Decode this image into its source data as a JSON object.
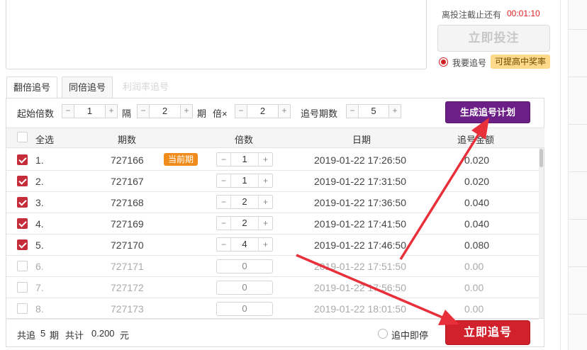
{
  "bet": {
    "deadline_label": "离投注截止还有",
    "deadline_time": "00:01:10",
    "bet_now_label": "立即投注",
    "want_chase_label": "我要追号",
    "rate_badge": "可提高中奖率"
  },
  "tabs": [
    {
      "label": "翻倍追号",
      "active": true
    },
    {
      "label": "同倍追号",
      "active": false
    },
    {
      "label": "利润率追号",
      "active": false,
      "disabled": true
    }
  ],
  "controls": {
    "start_multiple_label": "起始倍数",
    "start_multiple": "1",
    "every_label": "隔",
    "every_value": "2",
    "period_label": "期",
    "times_label": "倍×",
    "times_value": "2",
    "chase_periods_label": "追号期数",
    "chase_periods": "5",
    "generate_label": "生成追号计划"
  },
  "table": {
    "headers": {
      "select_all": "全选",
      "period": "期数",
      "multiple": "倍数",
      "date": "日期",
      "amount": "追号金额"
    },
    "current_badge": "当前期",
    "rows": [
      {
        "idx": "1.",
        "period": "727166",
        "multiple": "1",
        "date": "2019-01-22 17:26:50",
        "amount": "0.020",
        "checked": true
      },
      {
        "idx": "2.",
        "period": "727167",
        "multiple": "1",
        "date": "2019-01-22 17:31:50",
        "amount": "0.020",
        "checked": true
      },
      {
        "idx": "3.",
        "period": "727168",
        "multiple": "2",
        "date": "2019-01-22 17:36:50",
        "amount": "0.040",
        "checked": true
      },
      {
        "idx": "4.",
        "period": "727169",
        "multiple": "2",
        "date": "2019-01-22 17:41:50",
        "amount": "0.040",
        "checked": true
      },
      {
        "idx": "5.",
        "period": "727170",
        "multiple": "4",
        "date": "2019-01-22 17:46:50",
        "amount": "0.080",
        "checked": true
      },
      {
        "idx": "6.",
        "period": "727171",
        "multiple": "0",
        "date": "2019-01-22 17:51:50",
        "amount": "0.00",
        "checked": false
      },
      {
        "idx": "7.",
        "period": "727172",
        "multiple": "0",
        "date": "2019-01-22 17:56:50",
        "amount": "0.00",
        "checked": false
      },
      {
        "idx": "8.",
        "period": "727173",
        "multiple": "0",
        "date": "2019-01-22 18:01:50",
        "amount": "0.00",
        "checked": false
      }
    ]
  },
  "footer": {
    "total_prefix": "共追",
    "total_periods": "5",
    "period_unit": "期",
    "sum_label": "共计",
    "sum_value": "0.200",
    "currency": "元",
    "stop_on_win_label": "追中即停",
    "chase_now_label": "立即追号"
  },
  "colors": {
    "accent_red": "#d0212c",
    "accent_purple": "#6c1f86",
    "annotation_arrow": "#e8303a"
  }
}
